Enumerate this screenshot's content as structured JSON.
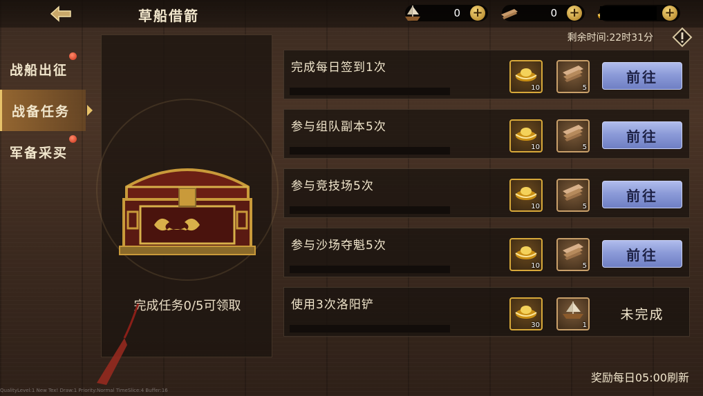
{
  "header": {
    "title": "草船借箭",
    "resources": [
      {
        "icon": "boat-icon",
        "value": "0"
      },
      {
        "icon": "wood-icon",
        "value": "0"
      },
      {
        "icon": "gold-ingot-icon",
        "value": ""
      }
    ],
    "timer_text": "剩余时间:22时31分"
  },
  "sidebar": {
    "items": [
      {
        "label": "战船出征",
        "active": false,
        "dot": true
      },
      {
        "label": "战备任务",
        "active": true,
        "dot": false
      },
      {
        "label": "军备采买",
        "active": false,
        "dot": true
      }
    ]
  },
  "chest": {
    "progress_text": "完成任务0/5可领取"
  },
  "tasks": [
    {
      "title": "完成每日签到1次",
      "rewards": [
        {
          "icon": "gold-ingot-icon",
          "count": "10"
        },
        {
          "icon": "wood-icon",
          "count": "5"
        }
      ],
      "action": "前往",
      "status": ""
    },
    {
      "title": "参与组队副本5次",
      "rewards": [
        {
          "icon": "gold-ingot-icon",
          "count": "10"
        },
        {
          "icon": "wood-icon",
          "count": "5"
        }
      ],
      "action": "前往",
      "status": ""
    },
    {
      "title": "参与竞技场5次",
      "rewards": [
        {
          "icon": "gold-ingot-icon",
          "count": "10"
        },
        {
          "icon": "wood-icon",
          "count": "5"
        }
      ],
      "action": "前往",
      "status": ""
    },
    {
      "title": "参与沙场夺魁5次",
      "rewards": [
        {
          "icon": "gold-ingot-icon",
          "count": "10"
        },
        {
          "icon": "wood-icon",
          "count": "5"
        }
      ],
      "action": "前往",
      "status": ""
    },
    {
      "title": "使用3次洛阳铲",
      "rewards": [
        {
          "icon": "gold-ingot-icon",
          "count": "30"
        },
        {
          "icon": "boat-icon",
          "count": "1"
        }
      ],
      "action": "",
      "status": "未完成"
    }
  ],
  "footer": {
    "refresh_text": "奖励每日05:00刷新",
    "debug_text": "QualityLevel:1  New Tex!  Draw:1  Priority:Normal  TimeSlice:4  Buffer:16"
  },
  "colors": {
    "accent_gold": "#d8a93a",
    "button_blue": "#8c9bd8",
    "badge_red": "#c8321a"
  }
}
